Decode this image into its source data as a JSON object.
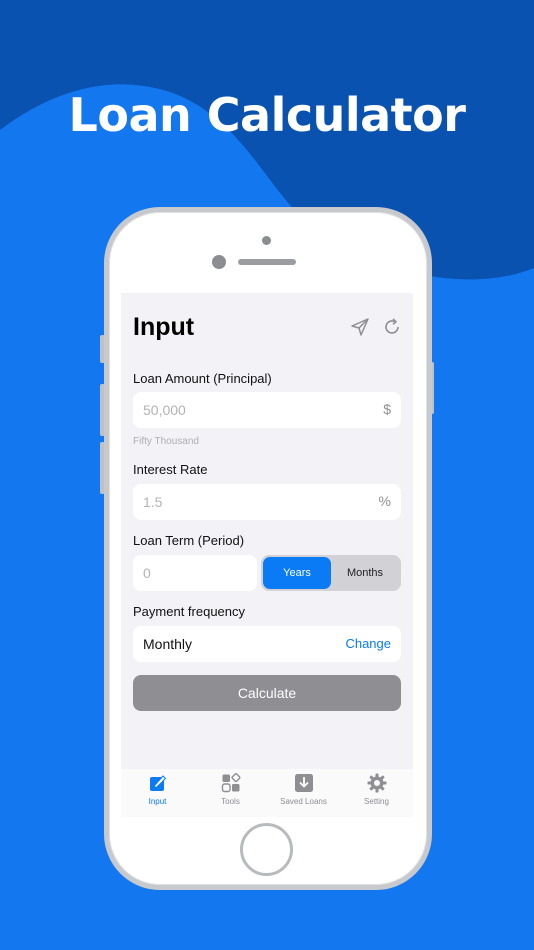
{
  "headline": "Loan Calculator",
  "colors": {
    "background": "#1377f0",
    "background_dark": "#0a52b0",
    "accent": "#0a7bf5",
    "disabled_button": "#8e8e93"
  },
  "screen": {
    "title": "Input",
    "icons": [
      "send-icon",
      "refresh-icon"
    ],
    "loan_amount": {
      "label": "Loan Amount (Principal)",
      "placeholder": "50,000",
      "unit": "$",
      "hint": "Fifty Thousand"
    },
    "interest_rate": {
      "label": "Interest Rate",
      "placeholder": "1.5",
      "unit": "%"
    },
    "loan_term": {
      "label": "Loan Term (Period)",
      "placeholder": "0",
      "options": [
        "Years",
        "Months"
      ],
      "selected": "Years"
    },
    "payment_frequency": {
      "label": "Payment frequency",
      "value": "Monthly",
      "change_label": "Change"
    },
    "calculate_label": "Calculate"
  },
  "tabbar": {
    "items": [
      {
        "label": "Input",
        "icon": "edit-icon",
        "active": true
      },
      {
        "label": "Tools",
        "icon": "tools-icon",
        "active": false
      },
      {
        "label": "Saved Loans",
        "icon": "download-icon",
        "active": false
      },
      {
        "label": "Setting",
        "icon": "gear-icon",
        "active": false
      }
    ]
  }
}
